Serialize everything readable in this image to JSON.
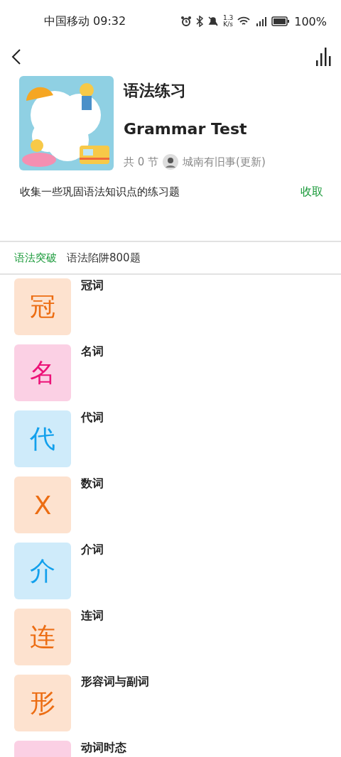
{
  "status_bar": {
    "carrier_time": "中国移动 09:32",
    "speed": [
      "1.3",
      "K/s"
    ],
    "battery": "100%"
  },
  "course": {
    "title": "语法练习",
    "subtitle": "Grammar Test",
    "sections": "共 0 节",
    "author": "城南有旧事(更新)",
    "description": "收集一些巩固语法知识点的练习题",
    "collect": "收取"
  },
  "breadcrumb": [
    {
      "label": "语法突破",
      "selected": true
    },
    {
      "label": "语法陷阱800题",
      "selected": false
    }
  ],
  "lessons": [
    {
      "glyph": "冠",
      "title": "冠词",
      "color": "#fde2cf"
    },
    {
      "glyph": "名",
      "title": "名词",
      "color": "#fbd0e4"
    },
    {
      "glyph": "代",
      "title": "代词",
      "color": "#cfebfa"
    },
    {
      "glyph": "X",
      "title": "数词",
      "color": "#fde2cf"
    },
    {
      "glyph": "介",
      "title": "介词",
      "color": "#cfebfa"
    },
    {
      "glyph": "连",
      "title": "连词",
      "color": "#fde2cf"
    },
    {
      "glyph": "形",
      "title": "形容词与副词",
      "color": "#fde2cf"
    },
    {
      "title": "动词时态",
      "color": "#fbd0e4"
    }
  ]
}
